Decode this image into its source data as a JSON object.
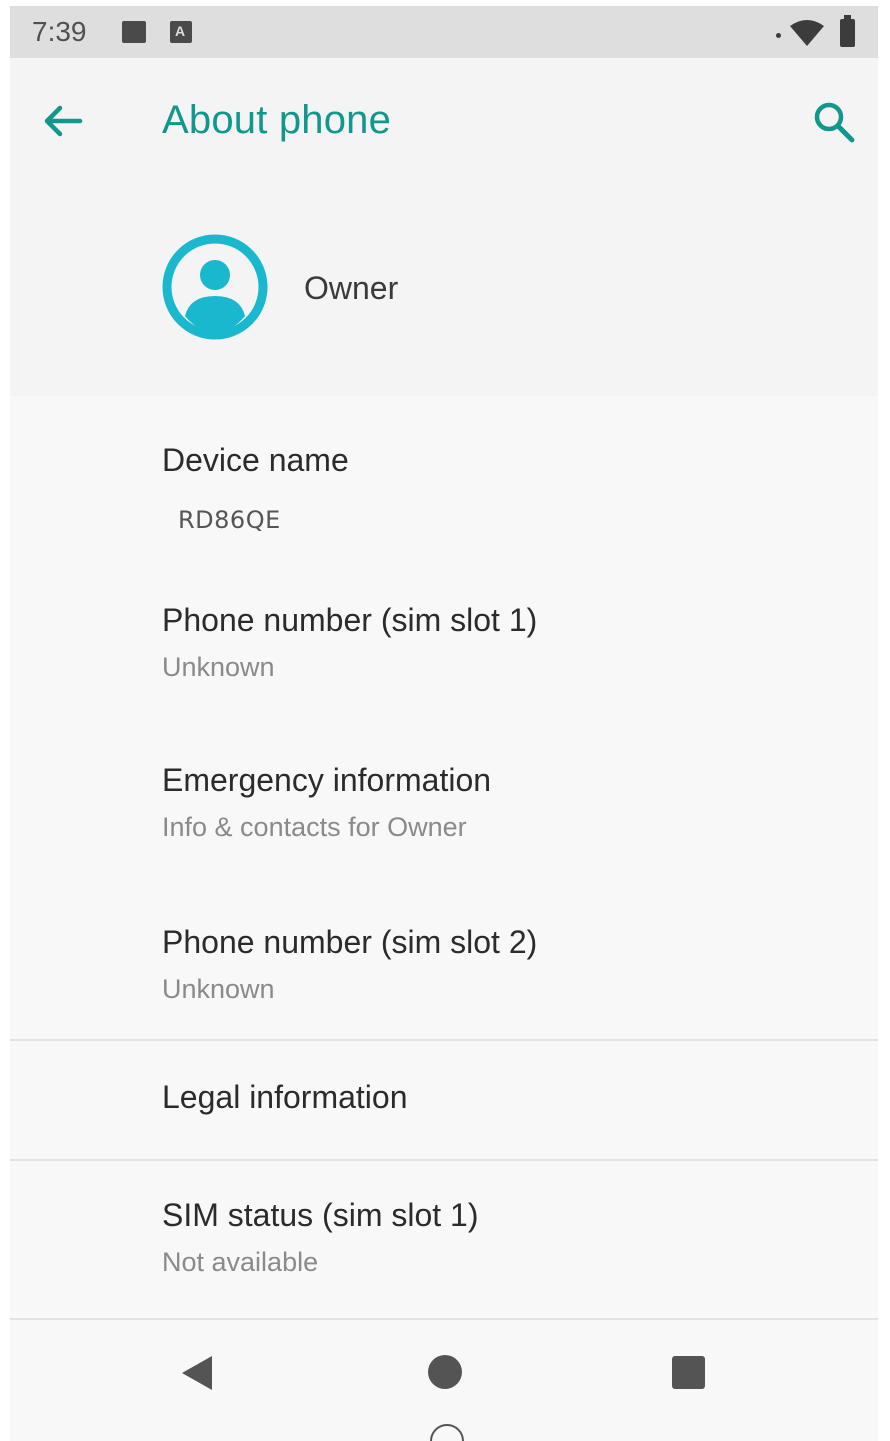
{
  "status_bar": {
    "time": "7:39",
    "icons": [
      "image-icon",
      "a-letter-icon",
      "signal-dot-icon",
      "wifi-icon",
      "battery-icon"
    ]
  },
  "toolbar": {
    "title": "About phone",
    "accent_color": "#12978c"
  },
  "owner": {
    "name": "Owner",
    "avatar_color": "#1ab8cf"
  },
  "items": [
    {
      "title": "Device name",
      "value": "RD86QE"
    },
    {
      "title": "Phone number (sim slot 1)",
      "summary": "Unknown"
    },
    {
      "title": "Emergency information",
      "summary": "Info & contacts for Owner"
    },
    {
      "title": "Phone number (sim slot 2)",
      "summary": "Unknown"
    },
    {
      "title": "Legal information"
    },
    {
      "title": "SIM status (sim slot 1)",
      "summary": "Not available"
    }
  ],
  "nav_bar": {
    "icons": [
      "back-triangle-icon",
      "home-circle-icon",
      "recents-square-icon"
    ]
  }
}
